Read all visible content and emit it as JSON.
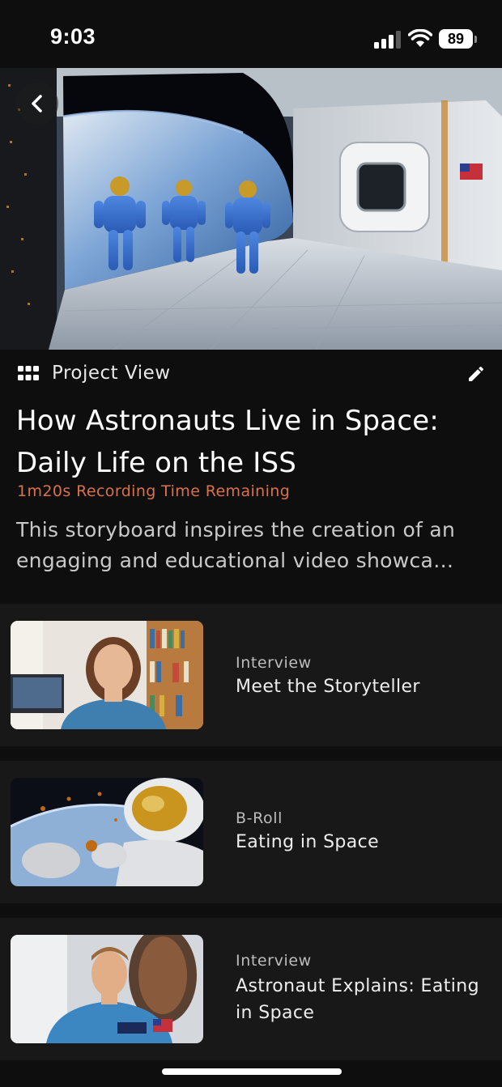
{
  "status_bar": {
    "time": "9:03",
    "battery_level": "89",
    "icons": [
      "signal-icon",
      "wifi-icon",
      "battery-icon"
    ]
  },
  "hero": {
    "image": "astronauts-space-station-image",
    "back_icon": "chevron-left-icon"
  },
  "project": {
    "view_label": "Project View",
    "view_icon": "grid-icon",
    "edit_icon": "pencil-icon",
    "title": "How Astronauts Live in Space: Daily Life on the ISS",
    "recording_remaining": "1m20s Recording Time Remaining",
    "description": "This storyboard inspires the creation of an engaging and educational video showca…"
  },
  "scenes": [
    {
      "type": "Interview",
      "title": "Meet the Storyteller",
      "thumbnail": "woman-interview-thumbnail"
    },
    {
      "type": "B-Roll",
      "title": "Eating in Space",
      "thumbnail": "astronaut-eating-thumbnail"
    },
    {
      "type": "Interview",
      "title": "Astronaut Explains: Eating in Space",
      "thumbnail": "astronaut-portrait-thumbnail"
    }
  ],
  "colors": {
    "background": "#0e0e0e",
    "card": "#181818",
    "accent_orange": "#d9724a",
    "text_primary": "#ffffff",
    "text_secondary": "#c9c9c9"
  }
}
